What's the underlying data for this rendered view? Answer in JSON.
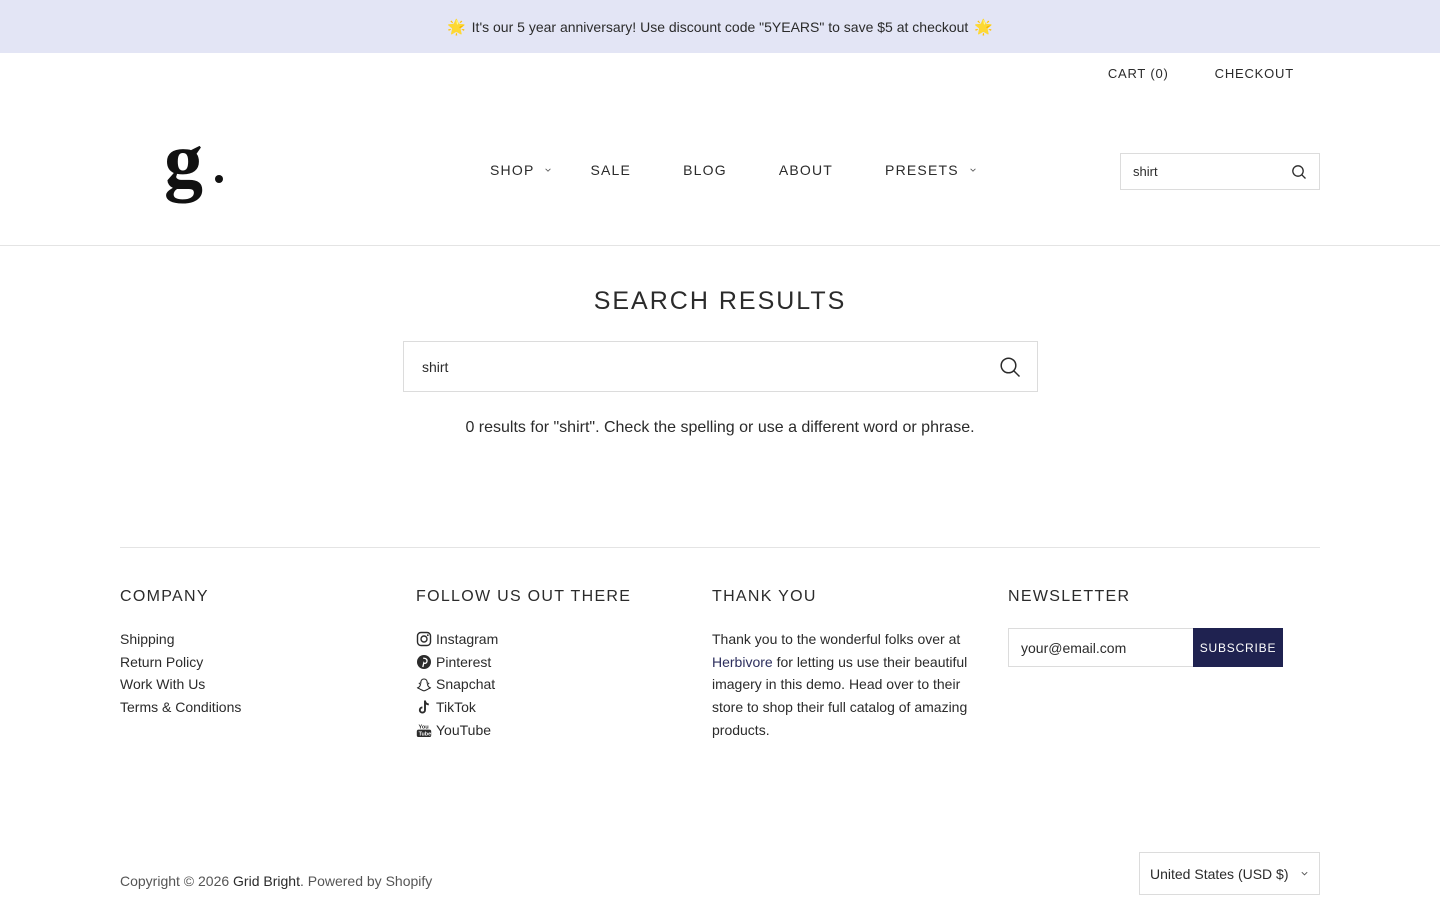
{
  "announcement": {
    "text": "It's our 5 year anniversary! Use discount code \"5YEARS\" to save $5 at checkout",
    "icon": "star-emoji"
  },
  "header": {
    "cart_label": "CART (0)",
    "checkout_label": "CHECKOUT",
    "logo_alt": "g.",
    "nav": [
      {
        "label": "SHOP",
        "has_dropdown": true
      },
      {
        "label": "SALE",
        "has_dropdown": false
      },
      {
        "label": "BLOG",
        "has_dropdown": false
      },
      {
        "label": "ABOUT",
        "has_dropdown": false
      },
      {
        "label": "PRESETS",
        "has_dropdown": true
      }
    ],
    "search": {
      "value": "shirt",
      "icon": "search-icon"
    }
  },
  "main": {
    "title": "SEARCH RESULTS",
    "search": {
      "value": "shirt",
      "icon": "search-icon"
    },
    "result_message": "0 results for \"shirt\". Check the spelling or use a different word or phrase."
  },
  "footer": {
    "company": {
      "heading": "COMPANY",
      "links": [
        "Shipping",
        "Return Policy",
        "Work With Us",
        "Terms & Conditions"
      ]
    },
    "social": {
      "heading": "FOLLOW US OUT THERE",
      "links": [
        {
          "label": "Instagram",
          "icon": "instagram-icon"
        },
        {
          "label": "Pinterest",
          "icon": "pinterest-icon"
        },
        {
          "label": "Snapchat",
          "icon": "snapchat-icon"
        },
        {
          "label": "TikTok",
          "icon": "tiktok-icon"
        },
        {
          "label": "YouTube",
          "icon": "youtube-icon"
        }
      ]
    },
    "thanks": {
      "heading": "THANK YOU",
      "text_before": "Thank you to the wonderful folks over at ",
      "link": "Herbivore",
      "text_after": " for letting us use their beautiful imagery in this demo. Head over to their store to shop their full catalog of amazing products."
    },
    "newsletter": {
      "heading": "NEWSLETTER",
      "placeholder": "your@email.com",
      "button": "SUBSCRIBE",
      "button_color": "#1f2250"
    },
    "copyright_prefix": "Copyright © 2026 ",
    "store_name": "Grid Bright",
    "powered_by": ". Powered by Shopify",
    "currency": "United States (USD $)"
  },
  "colors": {
    "announcement_bg": "#e3e5f5",
    "text": "#2b2b2b",
    "accent": "#1f2250"
  }
}
